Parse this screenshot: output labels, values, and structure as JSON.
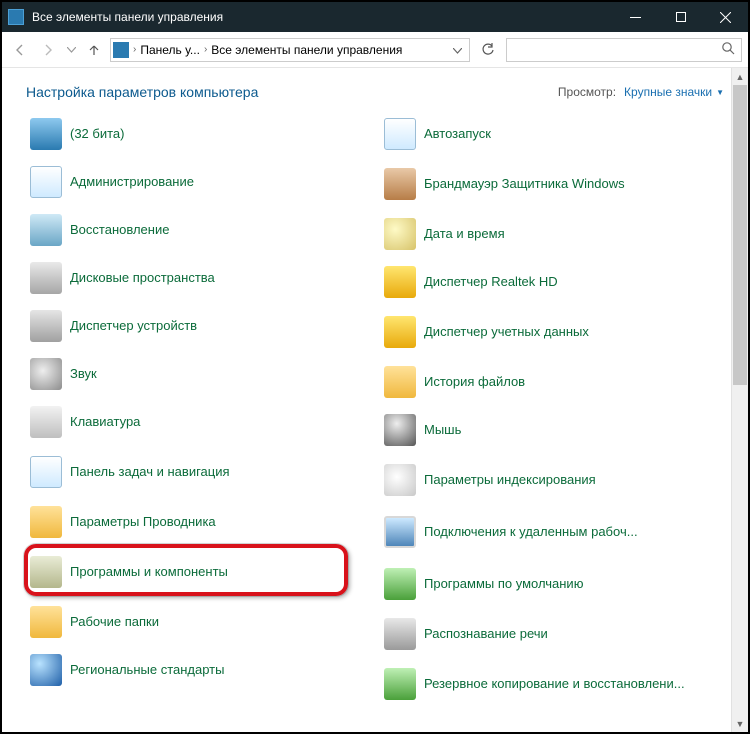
{
  "titlebar": {
    "title": "Все элементы панели управления"
  },
  "breadcrumb": {
    "part1": "Панель у...",
    "part2": "Все элементы панели управления"
  },
  "header": {
    "title": "Настройка параметров компьютера",
    "view_label": "Просмотр:",
    "view_value": "Крупные значки"
  },
  "left_items": [
    {
      "name": "item-32bit",
      "icon": "ic-blue",
      "label": "(32 бита)"
    },
    {
      "name": "item-administration",
      "icon": "ic-window",
      "label": "Администрирование"
    },
    {
      "name": "item-recovery",
      "icon": "ic-mon",
      "label": "Восстановление"
    },
    {
      "name": "item-storage",
      "icon": "ic-drive",
      "label": "Дисковые пространства"
    },
    {
      "name": "item-device-mgr",
      "icon": "ic-dev",
      "label": "Диспетчер устройств"
    },
    {
      "name": "item-sound",
      "icon": "ic-speaker",
      "label": "Звук"
    },
    {
      "name": "item-keyboard",
      "icon": "ic-keyb",
      "label": "Клавиатура"
    },
    {
      "name": "item-taskbar",
      "icon": "ic-window",
      "label": "Панель задач и навигация",
      "multi": true
    },
    {
      "name": "item-explorer-opts",
      "icon": "ic-folder",
      "label": "Параметры Проводника"
    },
    {
      "name": "item-programs",
      "icon": "ic-box",
      "label": "Программы и компоненты",
      "multi": true,
      "highlight": true
    },
    {
      "name": "item-workfolders",
      "icon": "ic-folder",
      "label": "Рабочие папки"
    },
    {
      "name": "item-regional",
      "icon": "ic-globe",
      "label": "Региональные стандарты"
    }
  ],
  "right_items": [
    {
      "name": "item-autoplay",
      "icon": "ic-window",
      "label": "Автозапуск"
    },
    {
      "name": "item-firewall",
      "icon": "ic-wall",
      "label": "Брандмауэр Защитника Windows",
      "multi": true
    },
    {
      "name": "item-datetime",
      "icon": "ic-clock",
      "label": "Дата и время"
    },
    {
      "name": "item-realtek",
      "icon": "ic-yellow",
      "label": "Диспетчер Realtek HD"
    },
    {
      "name": "item-cred-mgr",
      "icon": "ic-yellow",
      "label": "Диспетчер учетных данных",
      "multi": true
    },
    {
      "name": "item-filehistory",
      "icon": "ic-folder",
      "label": "История файлов"
    },
    {
      "name": "item-mouse",
      "icon": "ic-mouse",
      "label": "Мышь"
    },
    {
      "name": "item-indexing",
      "icon": "ic-mag",
      "label": "Параметры индексирования",
      "multi": true
    },
    {
      "name": "item-remote",
      "icon": "ic-screen",
      "label": "Подключения к удаленным рабоч...",
      "multi": true
    },
    {
      "name": "item-default-prog",
      "icon": "ic-green",
      "label": "Программы по умолчанию",
      "multi": true
    },
    {
      "name": "item-speech",
      "icon": "ic-mic",
      "label": "Распознавание речи"
    },
    {
      "name": "item-backup",
      "icon": "ic-green",
      "label": "Резервное копирование и восстановлени...",
      "multi": true
    }
  ]
}
